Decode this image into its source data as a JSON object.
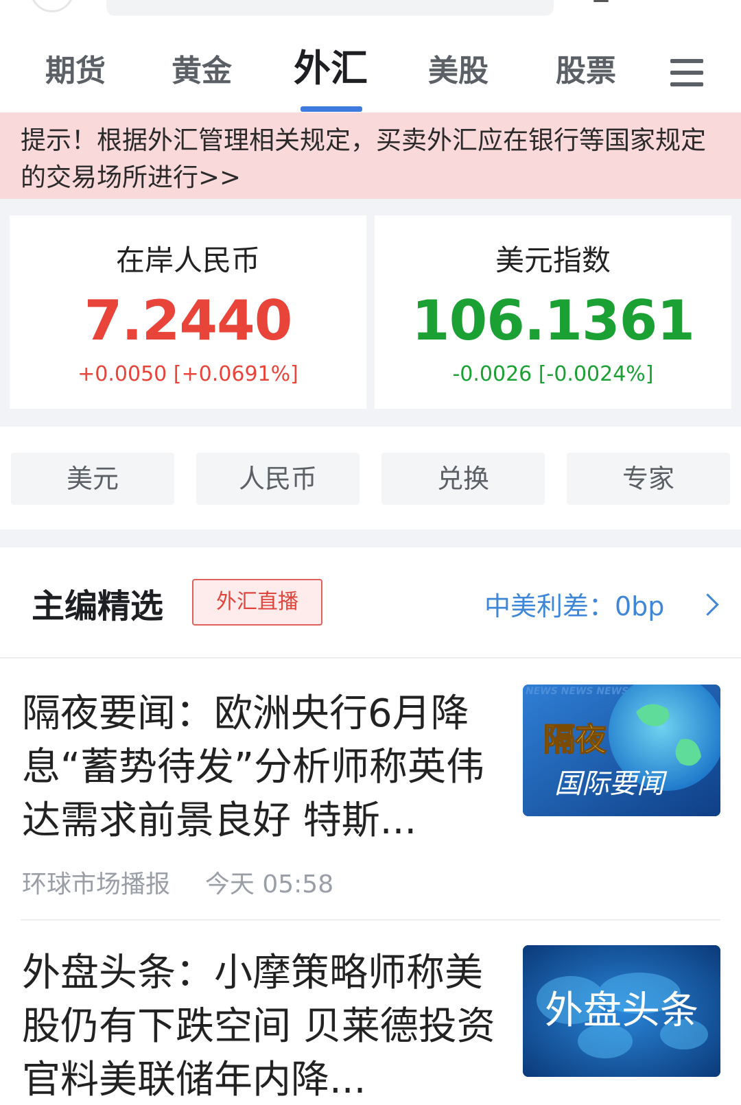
{
  "tabs": [
    "期货",
    "黄金",
    "外汇",
    "美股",
    "股票"
  ],
  "active_tab": "外汇",
  "notice": "提示！根据外汇管理相关规定，买卖外汇应在银行等国家规定的交易场所进行>>",
  "quotes": [
    {
      "name": "在岸人民币",
      "value": "7.2440",
      "change": "+0.0050 [+0.0691%]",
      "color": "#e8443a"
    },
    {
      "name": "美元指数",
      "value": "106.1361",
      "change": "-0.0026 [-0.0024%]",
      "color": "#1aa033"
    }
  ],
  "shortcuts": [
    "美元",
    "人民币",
    "兑换",
    "专家"
  ],
  "picks": {
    "title": "主编精选",
    "badge": "外汇直播",
    "spread": "中美利差：0bp"
  },
  "news": [
    {
      "headline": "隔夜要闻：欧洲央行6月降息“蓄势待发”分析师称英伟达需求前景良好 特斯...",
      "source": "环球市场播报",
      "time": "今天 05:58",
      "thumb_line1": "隔夜",
      "thumb_line2": "国际要闻",
      "thumb_bg_text": "NEWS NEWS NEWS NEWS"
    },
    {
      "headline": "外盘头条：小摩策略师称美股仍有下跌空间 贝莱德投资官料美联储年内降...",
      "thumb_text": "外盘头条"
    }
  ]
}
